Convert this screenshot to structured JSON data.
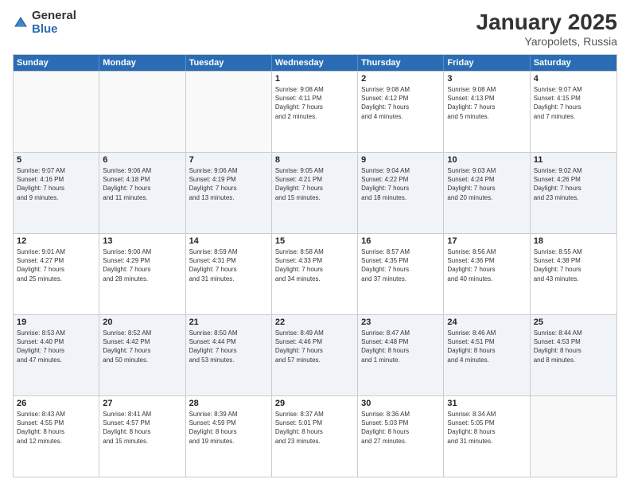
{
  "logo": {
    "general": "General",
    "blue": "Blue"
  },
  "title": {
    "month": "January 2025",
    "location": "Yaropolets, Russia"
  },
  "header": {
    "days": [
      "Sunday",
      "Monday",
      "Tuesday",
      "Wednesday",
      "Thursday",
      "Friday",
      "Saturday"
    ]
  },
  "weeks": [
    [
      {
        "day": "",
        "info": ""
      },
      {
        "day": "",
        "info": ""
      },
      {
        "day": "",
        "info": ""
      },
      {
        "day": "1",
        "info": "Sunrise: 9:08 AM\nSunset: 4:11 PM\nDaylight: 7 hours\nand 2 minutes."
      },
      {
        "day": "2",
        "info": "Sunrise: 9:08 AM\nSunset: 4:12 PM\nDaylight: 7 hours\nand 4 minutes."
      },
      {
        "day": "3",
        "info": "Sunrise: 9:08 AM\nSunset: 4:13 PM\nDaylight: 7 hours\nand 5 minutes."
      },
      {
        "day": "4",
        "info": "Sunrise: 9:07 AM\nSunset: 4:15 PM\nDaylight: 7 hours\nand 7 minutes."
      }
    ],
    [
      {
        "day": "5",
        "info": "Sunrise: 9:07 AM\nSunset: 4:16 PM\nDaylight: 7 hours\nand 9 minutes."
      },
      {
        "day": "6",
        "info": "Sunrise: 9:06 AM\nSunset: 4:18 PM\nDaylight: 7 hours\nand 11 minutes."
      },
      {
        "day": "7",
        "info": "Sunrise: 9:06 AM\nSunset: 4:19 PM\nDaylight: 7 hours\nand 13 minutes."
      },
      {
        "day": "8",
        "info": "Sunrise: 9:05 AM\nSunset: 4:21 PM\nDaylight: 7 hours\nand 15 minutes."
      },
      {
        "day": "9",
        "info": "Sunrise: 9:04 AM\nSunset: 4:22 PM\nDaylight: 7 hours\nand 18 minutes."
      },
      {
        "day": "10",
        "info": "Sunrise: 9:03 AM\nSunset: 4:24 PM\nDaylight: 7 hours\nand 20 minutes."
      },
      {
        "day": "11",
        "info": "Sunrise: 9:02 AM\nSunset: 4:26 PM\nDaylight: 7 hours\nand 23 minutes."
      }
    ],
    [
      {
        "day": "12",
        "info": "Sunrise: 9:01 AM\nSunset: 4:27 PM\nDaylight: 7 hours\nand 25 minutes."
      },
      {
        "day": "13",
        "info": "Sunrise: 9:00 AM\nSunset: 4:29 PM\nDaylight: 7 hours\nand 28 minutes."
      },
      {
        "day": "14",
        "info": "Sunrise: 8:59 AM\nSunset: 4:31 PM\nDaylight: 7 hours\nand 31 minutes."
      },
      {
        "day": "15",
        "info": "Sunrise: 8:58 AM\nSunset: 4:33 PM\nDaylight: 7 hours\nand 34 minutes."
      },
      {
        "day": "16",
        "info": "Sunrise: 8:57 AM\nSunset: 4:35 PM\nDaylight: 7 hours\nand 37 minutes."
      },
      {
        "day": "17",
        "info": "Sunrise: 8:56 AM\nSunset: 4:36 PM\nDaylight: 7 hours\nand 40 minutes."
      },
      {
        "day": "18",
        "info": "Sunrise: 8:55 AM\nSunset: 4:38 PM\nDaylight: 7 hours\nand 43 minutes."
      }
    ],
    [
      {
        "day": "19",
        "info": "Sunrise: 8:53 AM\nSunset: 4:40 PM\nDaylight: 7 hours\nand 47 minutes."
      },
      {
        "day": "20",
        "info": "Sunrise: 8:52 AM\nSunset: 4:42 PM\nDaylight: 7 hours\nand 50 minutes."
      },
      {
        "day": "21",
        "info": "Sunrise: 8:50 AM\nSunset: 4:44 PM\nDaylight: 7 hours\nand 53 minutes."
      },
      {
        "day": "22",
        "info": "Sunrise: 8:49 AM\nSunset: 4:46 PM\nDaylight: 7 hours\nand 57 minutes."
      },
      {
        "day": "23",
        "info": "Sunrise: 8:47 AM\nSunset: 4:48 PM\nDaylight: 8 hours\nand 1 minute."
      },
      {
        "day": "24",
        "info": "Sunrise: 8:46 AM\nSunset: 4:51 PM\nDaylight: 8 hours\nand 4 minutes."
      },
      {
        "day": "25",
        "info": "Sunrise: 8:44 AM\nSunset: 4:53 PM\nDaylight: 8 hours\nand 8 minutes."
      }
    ],
    [
      {
        "day": "26",
        "info": "Sunrise: 8:43 AM\nSunset: 4:55 PM\nDaylight: 8 hours\nand 12 minutes."
      },
      {
        "day": "27",
        "info": "Sunrise: 8:41 AM\nSunset: 4:57 PM\nDaylight: 8 hours\nand 15 minutes."
      },
      {
        "day": "28",
        "info": "Sunrise: 8:39 AM\nSunset: 4:59 PM\nDaylight: 8 hours\nand 19 minutes."
      },
      {
        "day": "29",
        "info": "Sunrise: 8:37 AM\nSunset: 5:01 PM\nDaylight: 8 hours\nand 23 minutes."
      },
      {
        "day": "30",
        "info": "Sunrise: 8:36 AM\nSunset: 5:03 PM\nDaylight: 8 hours\nand 27 minutes."
      },
      {
        "day": "31",
        "info": "Sunrise: 8:34 AM\nSunset: 5:05 PM\nDaylight: 8 hours\nand 31 minutes."
      },
      {
        "day": "",
        "info": ""
      }
    ]
  ]
}
